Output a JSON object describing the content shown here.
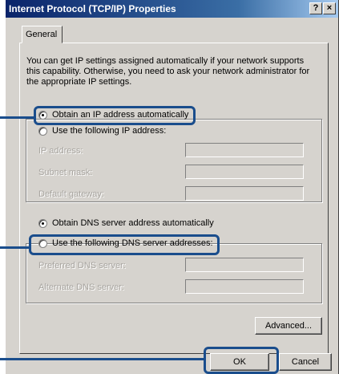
{
  "window": {
    "title": "Internet Protocol (TCP/IP) Properties",
    "help_btn": "?",
    "close_btn": "×"
  },
  "tabs": [
    {
      "label": "General"
    }
  ],
  "intro_text": "You can get IP settings assigned automatically if your network supports this capability. Otherwise, you need to ask your network administrator for the appropriate IP settings.",
  "ip": {
    "auto_label": "Obtain an IP address automatically",
    "manual_label": "Use the following IP address:",
    "selected": "auto",
    "fields": [
      {
        "label": "IP address:",
        "value": ""
      },
      {
        "label": "Subnet mask:",
        "value": ""
      },
      {
        "label": "Default gateway:",
        "value": ""
      }
    ]
  },
  "dns": {
    "auto_label": "Obtain DNS server address automatically",
    "manual_label": "Use the following DNS server addresses:",
    "selected": "auto",
    "fields": [
      {
        "label": "Preferred DNS server:",
        "value": ""
      },
      {
        "label": "Alternate DNS server:",
        "value": ""
      }
    ]
  },
  "buttons": {
    "advanced": "Advanced...",
    "ok": "OK",
    "cancel": "Cancel"
  },
  "colors": {
    "highlight": "#1a4d8c",
    "dialog_bg": "#d6d3ce",
    "titlebar": "#0a246a"
  }
}
